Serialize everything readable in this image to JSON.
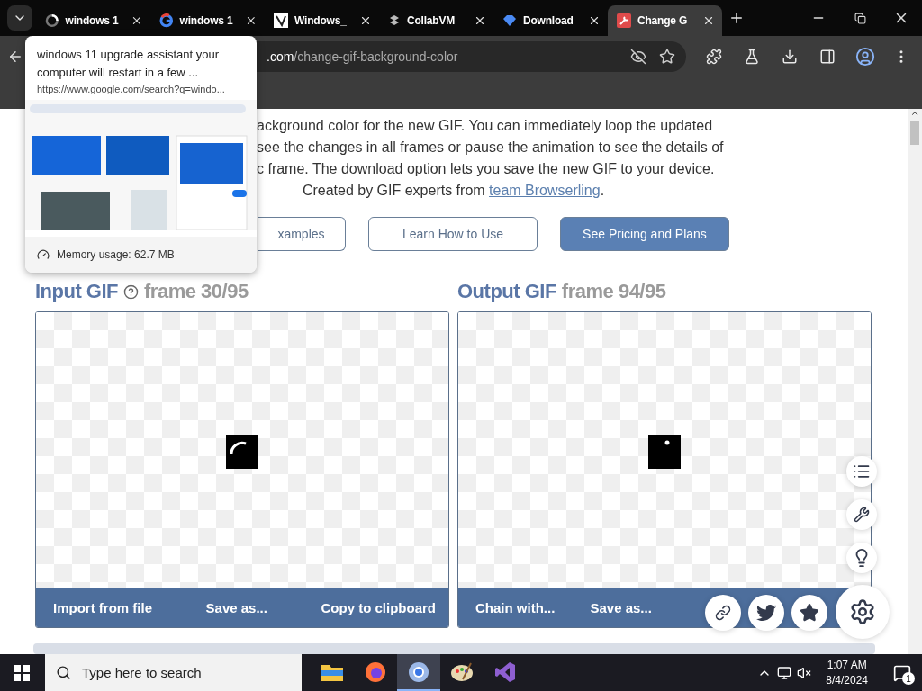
{
  "tab_strip": {
    "tabs": [
      {
        "title": "windows 1",
        "selected": false
      },
      {
        "title": "windows 1",
        "selected": false
      },
      {
        "title": "Windows_",
        "selected": false
      },
      {
        "title": "CollabVM",
        "selected": false
      },
      {
        "title": "Download",
        "selected": false
      },
      {
        "title": "Change G",
        "selected": true
      }
    ]
  },
  "address_bar": {
    "host": ".com",
    "path": "/change-gif-background-color"
  },
  "hover_card": {
    "title": "windows 11 upgrade assistant your computer will restart in a few ...",
    "url": "https://www.google.com/search?q=windo...",
    "memory": "Memory usage: 62.7 MB"
  },
  "intro": {
    "lines": [
      "ackground color for the new GIF. You can immediately loop the updated",
      "see the changes in all frames or pause the animation to see the details of",
      "c frame. The download option lets you save the new GIF to your device."
    ],
    "credit": "Created by GIF experts from ",
    "credit_link": "team Browserling",
    "credit_end": "."
  },
  "actions": [
    {
      "label": "xamples",
      "primary": false
    },
    {
      "label": "Learn How to Use",
      "primary": false
    },
    {
      "label": "See Pricing and Plans",
      "primary": true
    }
  ],
  "panels": [
    {
      "title": "Input GIF",
      "help": true,
      "frame": "frame 30/95",
      "buttons": [
        "Import from file",
        "Save as...",
        "Copy to clipboard"
      ]
    },
    {
      "title": "Output GIF",
      "help": false,
      "frame": "frame 94/95",
      "buttons": [
        "Chain with...",
        "Save as..."
      ]
    }
  ],
  "taskbar": {
    "search": {
      "placeholder": "Type here to search"
    },
    "apps": [
      {
        "kind": "folder",
        "selected": false
      },
      {
        "kind": "firefox",
        "selected": false
      },
      {
        "kind": "chrome",
        "selected": true
      },
      {
        "kind": "paint",
        "selected": false
      },
      {
        "kind": "studio",
        "selected": false
      }
    ],
    "time": "1:07 AM",
    "date": "8/4/2024",
    "notifications": "1"
  }
}
